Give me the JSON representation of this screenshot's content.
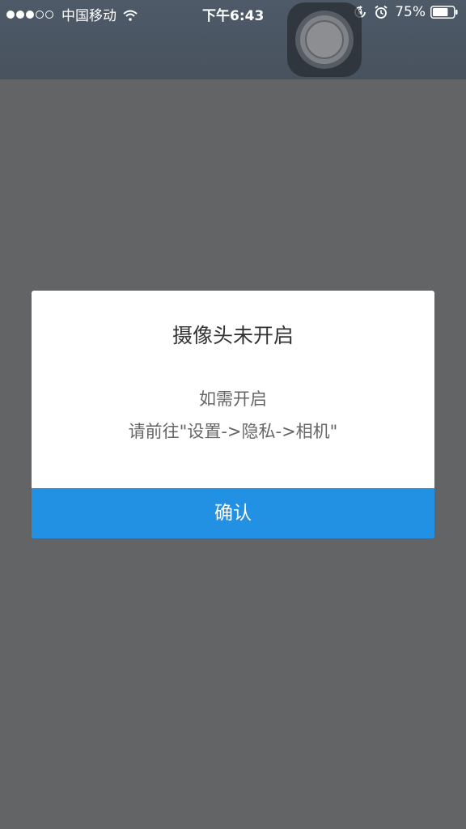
{
  "status_bar": {
    "signal_filled": 3,
    "signal_total": 5,
    "carrier": "中国移动",
    "time": "下午6:43",
    "battery_percent": "75%",
    "battery_level": 0.75,
    "icons": [
      "wifi-icon",
      "rotation-lock-icon",
      "alarm-icon",
      "battery-icon"
    ]
  },
  "dialog": {
    "title": "摄像头未开启",
    "line1": "如需开启",
    "line2": "请前往\"设置->隐私->相机\"",
    "confirm_label": "确认"
  },
  "colors": {
    "overlay": "#636466",
    "top_bar": "#4b5663",
    "confirm": "#2290e3"
  }
}
